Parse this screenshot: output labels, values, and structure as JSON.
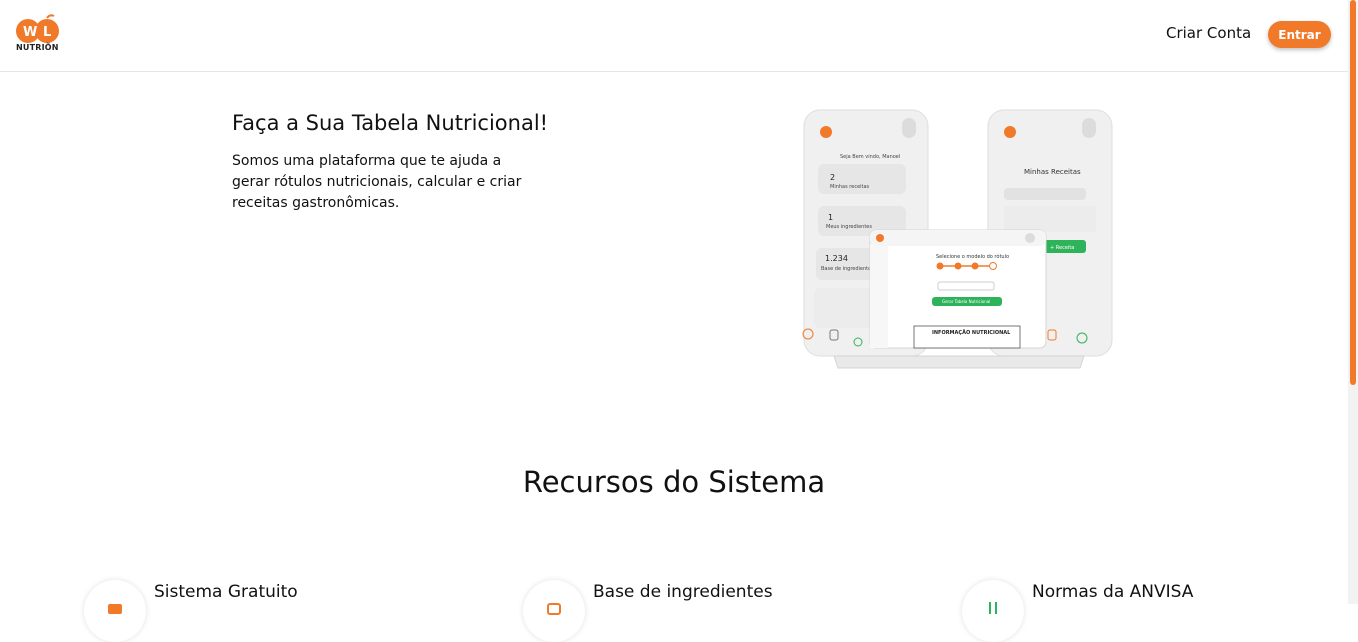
{
  "header": {
    "logo_text": "NUTRIÕN",
    "criar_conta": "Criar Conta",
    "entrar": "Entrar"
  },
  "hero": {
    "title": "Faça a Sua Tabela Nutricional!",
    "text": "Somos uma plataforma que te ajuda a gerar rótulos nutricionais, calcular e criar receitas gastronômicas."
  },
  "mockup": {
    "phone1_greeting": "Seja Bem vindo, Manoel",
    "card1_value": "2",
    "card1_label": "Minhas receitas",
    "card2_value": "1",
    "card2_label": "Meus ingredientes",
    "card3_value": "1.234",
    "card3_label": "Base de ingredientes",
    "phone2_title": "Minhas Receitas",
    "laptop_heading": "Selecione o modelo do rótulo",
    "laptop_button": "Gerar Tabela Nutricional",
    "laptop_table": "INFORMAÇÃO NUTRICIONAL",
    "phone2_button": "+ Receita"
  },
  "features": {
    "title": "Recursos do Sistema",
    "items": [
      {
        "title": "Sistema Gratuito"
      },
      {
        "title": "Base de ingredientes"
      },
      {
        "title": "Normas da ANVISA"
      }
    ]
  },
  "colors": {
    "accent": "#f07a2a",
    "green": "#2fb35a"
  }
}
